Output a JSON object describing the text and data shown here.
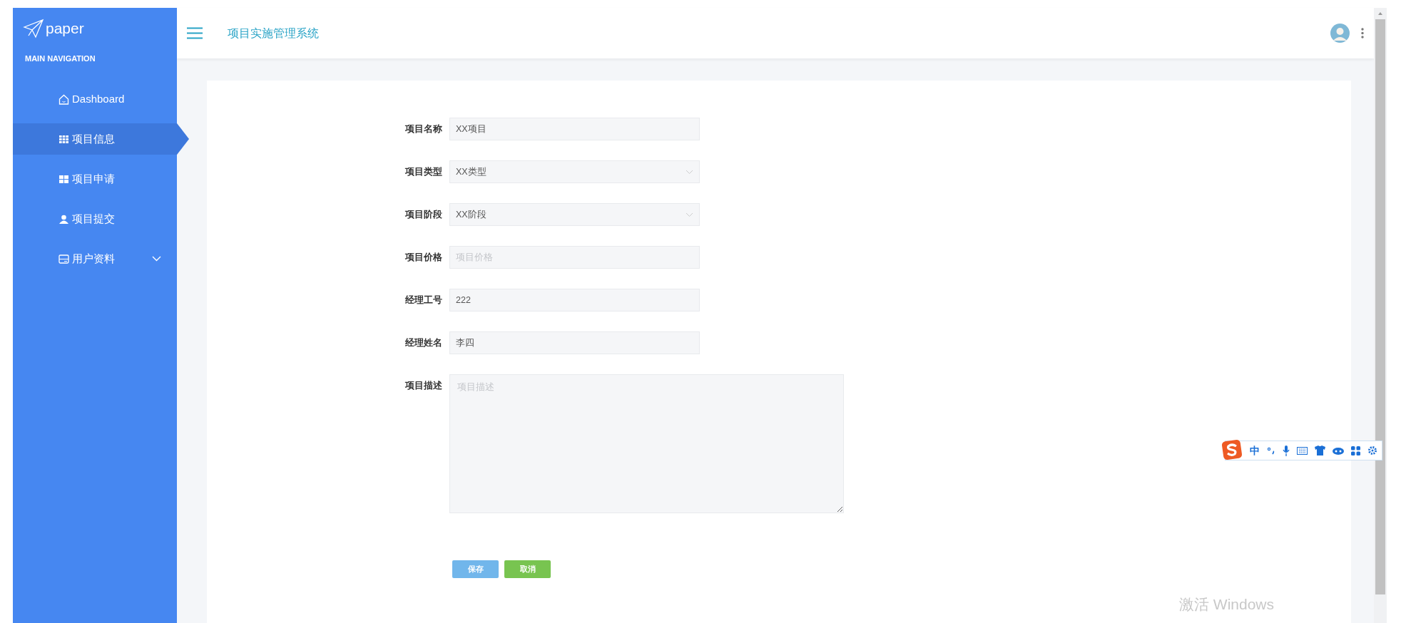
{
  "brand": "paper",
  "nav_heading": "MAIN NAVIGATION",
  "nav": [
    {
      "label": "Dashboard",
      "kind": "link",
      "selected": false
    },
    {
      "label": "项目信息",
      "kind": "link",
      "selected": true
    },
    {
      "label": "项目申请",
      "kind": "link",
      "selected": false
    },
    {
      "label": "项目提交",
      "kind": "link",
      "selected": false
    },
    {
      "label": "用户资料",
      "kind": "submenu",
      "selected": false
    }
  ],
  "header": {
    "title": "项目实施管理系统"
  },
  "form": [
    {
      "label": "项目名称",
      "kind": "text",
      "value": "XX项目"
    },
    {
      "label": "项目类型",
      "kind": "select",
      "value": "XX类型"
    },
    {
      "label": "项目阶段",
      "kind": "select",
      "value": "XX阶段"
    },
    {
      "label": "项目价格",
      "kind": "text",
      "placeholder": "项目价格"
    },
    {
      "label": "经理工号",
      "kind": "text",
      "value": "222"
    },
    {
      "label": "经理姓名",
      "kind": "text",
      "value": "李四"
    },
    {
      "label": "项目描述",
      "kind": "textarea",
      "placeholder": "项目描述"
    }
  ],
  "buttons": [
    {
      "label": "保存",
      "kind": "primary"
    },
    {
      "label": "取消",
      "kind": "success"
    }
  ],
  "ime": {
    "mode": "中"
  },
  "os_notice": "激活 Windows"
}
